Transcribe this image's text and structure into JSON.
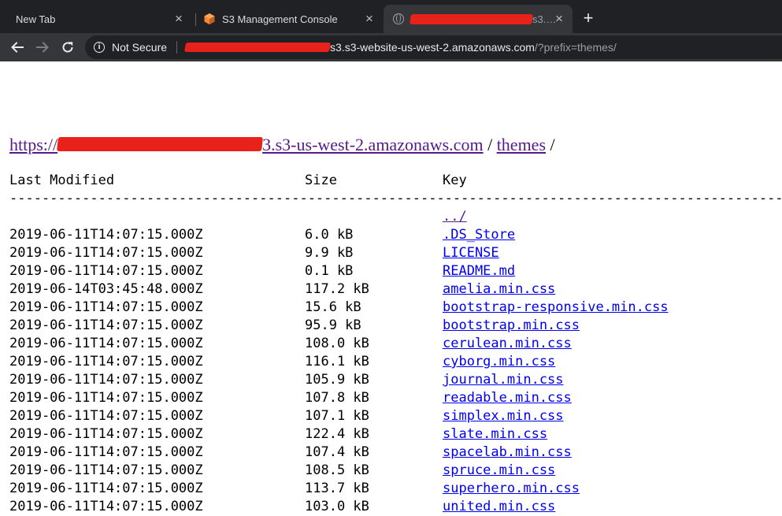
{
  "browser": {
    "tabs": [
      {
        "title": "New Tab",
        "active": false
      },
      {
        "title": "S3 Management Console",
        "active": false
      },
      {
        "title": "s3.…",
        "active": true
      }
    ],
    "new_tab_symbol": "+",
    "close_symbol": "×",
    "address": {
      "security_label": "Not Secure",
      "url_host_suffix": "s3.s3-website-us-west-2.amazonaws.com",
      "url_path": "/?prefix=themes/"
    }
  },
  "page": {
    "heading": {
      "root_link_suffix": "3.s3-us-west-2.amazonaws.com",
      "root_link_prefix": "https://",
      "separator1": " / ",
      "folder_link": "themes",
      "separator2": " /"
    },
    "columns": {
      "last_modified": "Last Modified",
      "size": "Size",
      "key": "Key"
    },
    "divider": "----------------------------------------------------------------------------------------------------------------",
    "parent_link": "../",
    "rows": [
      {
        "modified": "2019-06-11T14:07:15.000Z",
        "size": "6.0 kB",
        "key": ".DS_Store"
      },
      {
        "modified": "2019-06-11T14:07:15.000Z",
        "size": "9.9 kB",
        "key": "LICENSE"
      },
      {
        "modified": "2019-06-11T14:07:15.000Z",
        "size": "0.1 kB",
        "key": "README.md"
      },
      {
        "modified": "2019-06-14T03:45:48.000Z",
        "size": "117.2 kB",
        "key": "amelia.min.css"
      },
      {
        "modified": "2019-06-11T14:07:15.000Z",
        "size": "15.6 kB",
        "key": "bootstrap-responsive.min.css"
      },
      {
        "modified": "2019-06-11T14:07:15.000Z",
        "size": "95.9 kB",
        "key": "bootstrap.min.css"
      },
      {
        "modified": "2019-06-11T14:07:15.000Z",
        "size": "108.0 kB",
        "key": "cerulean.min.css"
      },
      {
        "modified": "2019-06-11T14:07:15.000Z",
        "size": "116.1 kB",
        "key": "cyborg.min.css"
      },
      {
        "modified": "2019-06-11T14:07:15.000Z",
        "size": "105.9 kB",
        "key": "journal.min.css"
      },
      {
        "modified": "2019-06-11T14:07:15.000Z",
        "size": "107.8 kB",
        "key": "readable.min.css"
      },
      {
        "modified": "2019-06-11T14:07:15.000Z",
        "size": "107.1 kB",
        "key": "simplex.min.css"
      },
      {
        "modified": "2019-06-11T14:07:15.000Z",
        "size": "122.4 kB",
        "key": "slate.min.css"
      },
      {
        "modified": "2019-06-11T14:07:15.000Z",
        "size": "107.4 kB",
        "key": "spacelab.min.css"
      },
      {
        "modified": "2019-06-11T14:07:15.000Z",
        "size": "108.5 kB",
        "key": "spruce.min.css"
      },
      {
        "modified": "2019-06-11T14:07:15.000Z",
        "size": "113.7 kB",
        "key": "superhero.min.css"
      },
      {
        "modified": "2019-06-11T14:07:15.000Z",
        "size": "103.0 kB",
        "key": "united.min.css"
      }
    ]
  },
  "colors": {
    "chrome_dark": "#202124",
    "chrome_mid": "#35363a",
    "link": "#0000ee",
    "visited_link": "#551a8b",
    "redaction": "#e8211a",
    "s3_icon": "#f58536"
  },
  "icons": [
    "s3-icon",
    "globe-icon",
    "close-icon",
    "plus-icon",
    "back-arrow-icon",
    "forward-arrow-icon",
    "reload-icon",
    "info-icon"
  ]
}
